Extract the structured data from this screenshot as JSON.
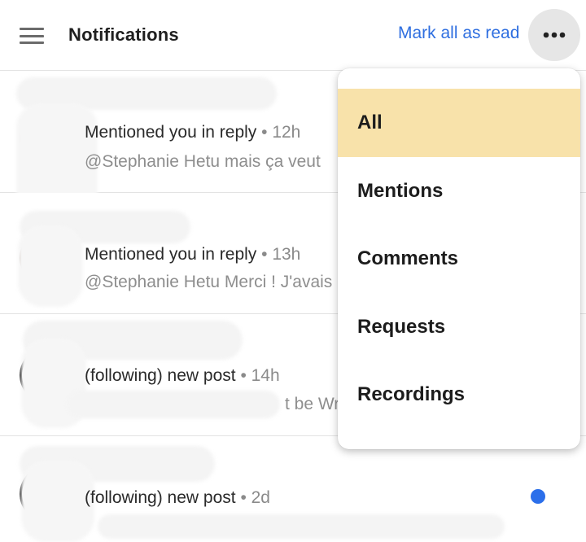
{
  "header": {
    "title": "Notifications",
    "mark_all_read": "Mark all as read",
    "menu_icon": "hamburger-icon",
    "more_icon": "more-horiz-icon"
  },
  "notifications": [
    {
      "action": "Mentioned you in reply",
      "time": "• 12h",
      "preview": "@Stephanie Hetu mais ça veut",
      "unread": false
    },
    {
      "action": "Mentioned you in reply",
      "time": "• 13h",
      "preview": "@Stephanie Hetu Merci ! J'avais",
      "unread": false
    },
    {
      "action": "(following) new post",
      "time": "• 14h",
      "preview": "t be Wro",
      "unread": false
    },
    {
      "action": "(following) new post",
      "time": "• 2d",
      "preview": "",
      "unread": true
    }
  ],
  "filter_menu": {
    "selected": "All",
    "items": [
      "All",
      "Mentions",
      "Comments",
      "Requests",
      "Recordings"
    ]
  },
  "colors": {
    "accent": "#2f6fe0",
    "selected_bg": "#f8e2aa",
    "unread_dot": "#2b6fea"
  }
}
